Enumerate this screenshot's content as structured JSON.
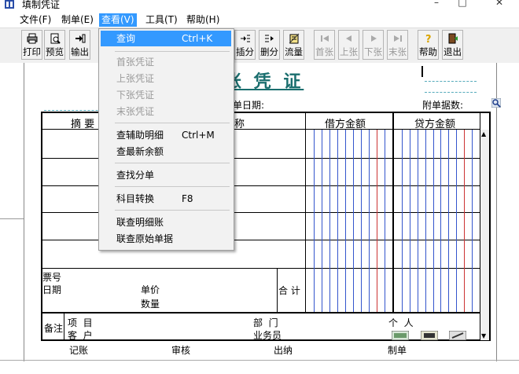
{
  "window": {
    "title": "填制凭证"
  },
  "menu": [
    {
      "label": "文件(F)"
    },
    {
      "label": "制单(E)"
    },
    {
      "label": "查看(V)"
    },
    {
      "label": "工具(T)"
    },
    {
      "label": "帮助(H)"
    }
  ],
  "toolbar": {
    "print": "打印",
    "preview": "预览",
    "output": "输出",
    "insert": "插分",
    "delete": "删分",
    "flow": "流量",
    "first": "首张",
    "prev": "上张",
    "next": "下张",
    "last": "末张",
    "help": "帮助",
    "exit": "退出"
  },
  "voucher": {
    "title": "账 凭 证",
    "date_label": "单日期:",
    "attach_label": "附单据数:",
    "col_summary": "摘 要",
    "col_account": "称",
    "col_debit": "借方金额",
    "col_credit": "贷方金额",
    "ticket_no": "票号",
    "date": "日期",
    "unit_price": "单价",
    "quantity": "数量",
    "total": "合 计",
    "remark": "备注",
    "project": "项  目",
    "customer": "客  户",
    "department": "部  门",
    "salesman": "业务员",
    "person": "个  人",
    "bookkeeping": "记账",
    "audit": "审核",
    "cashier": "出纳",
    "maker": "制单"
  },
  "view_menu": {
    "query": "查询",
    "query_shortcut": "Ctrl+K",
    "first": "首张凭证",
    "prev": "上张凭证",
    "next": "下张凭证",
    "last": "末张凭证",
    "aux_detail": "查辅助明细",
    "aux_shortcut": "Ctrl+M",
    "latest_balance": "查最新余额",
    "find_split": "查找分单",
    "subject_convert": "科目转换",
    "subject_shortcut": "F8",
    "linked_detail": "联查明细账",
    "linked_original": "联查原始单据"
  },
  "colors": {
    "accent": "#3399ff",
    "title": "#1a6e6e",
    "debit_line_red": "#cc3333",
    "debit_line_blue": "#3355cc"
  }
}
